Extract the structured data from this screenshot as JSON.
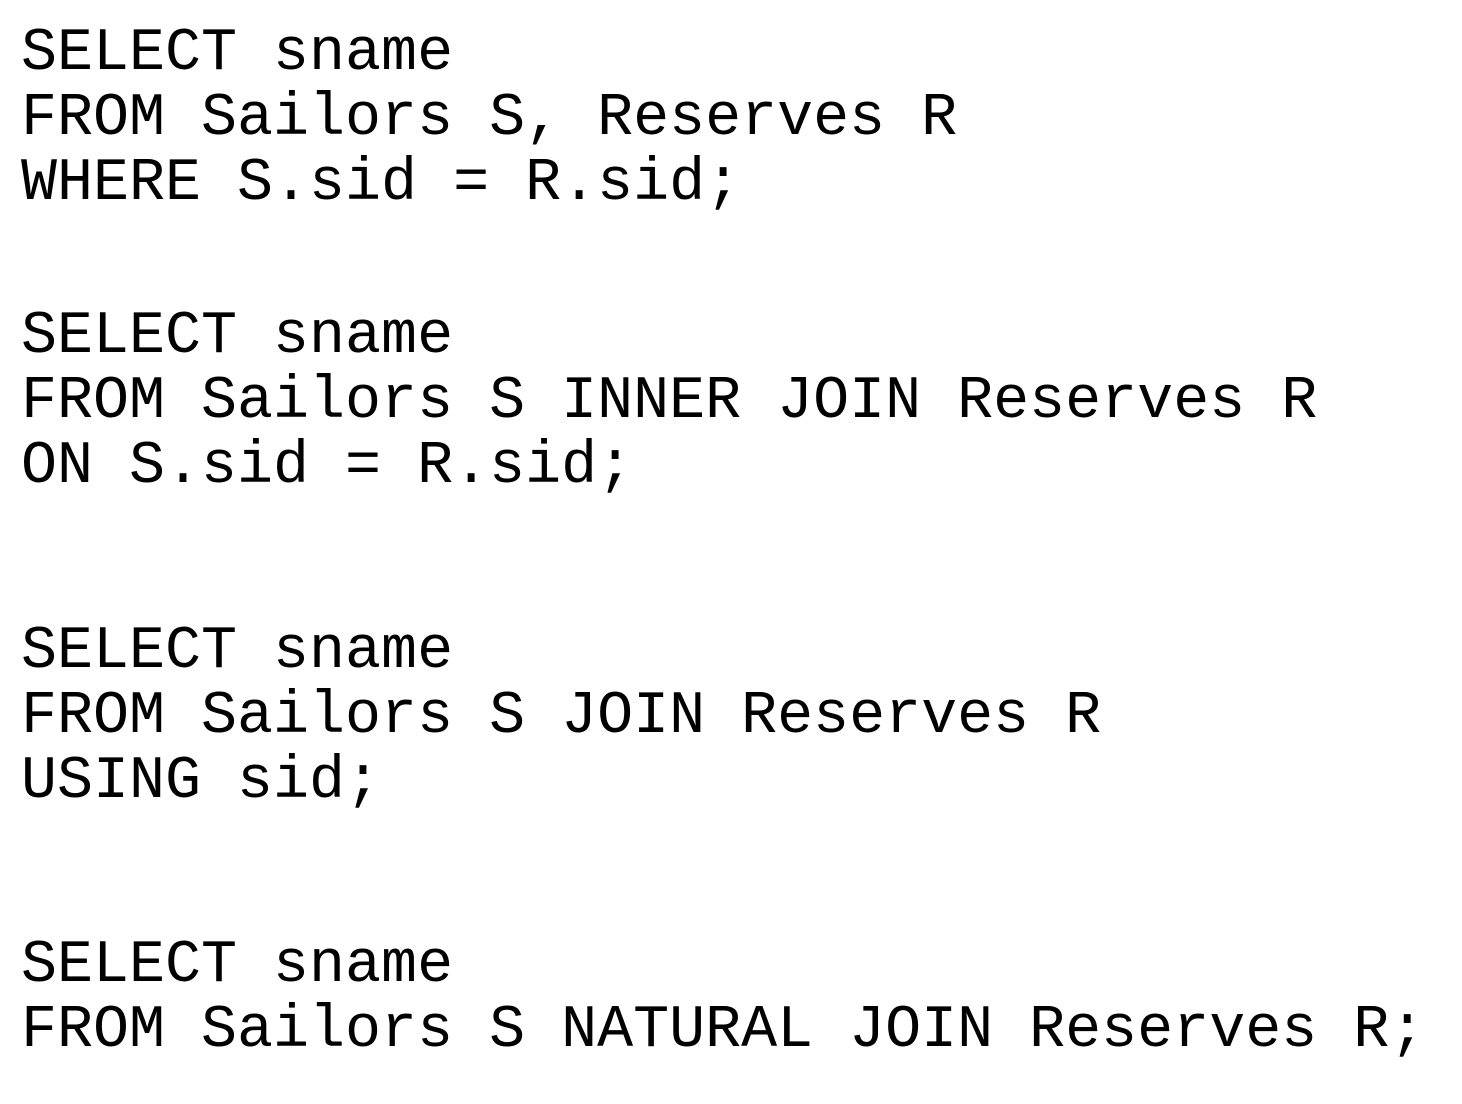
{
  "queries": [
    {
      "lines": [
        "SELECT sname",
        "FROM Sailors S, Reserves R",
        "WHERE S.sid = R.sid;"
      ]
    },
    {
      "lines": [
        "SELECT sname",
        "FROM Sailors S INNER JOIN Reserves R",
        "ON S.sid = R.sid;"
      ]
    },
    {
      "lines": [
        "SELECT sname",
        "FROM Sailors S JOIN Reserves R",
        "USING sid;"
      ]
    },
    {
      "lines": [
        "SELECT sname",
        "FROM Sailors S NATURAL JOIN Reserves R;"
      ]
    }
  ]
}
